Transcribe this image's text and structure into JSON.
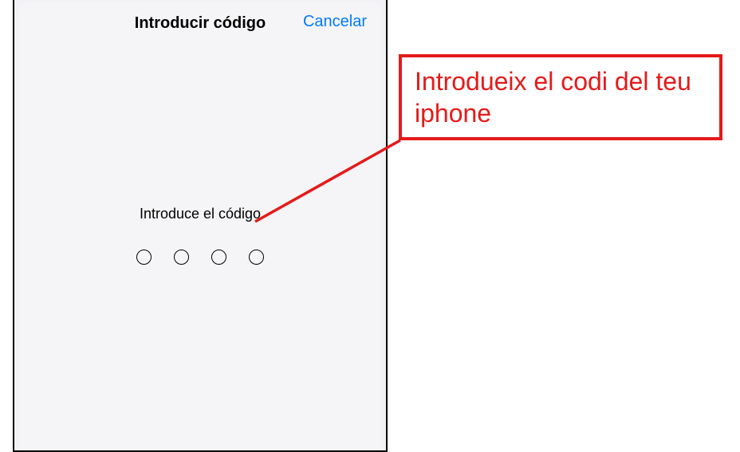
{
  "modal": {
    "title": "Introducir código",
    "cancel_label": "Cancelar",
    "prompt": "Introduce el código",
    "passcode_length": 4
  },
  "annotation": {
    "text": "Introdueix el codi del teu iphone"
  },
  "colors": {
    "accent_blue": "#007aff",
    "annotation_red": "#e51a1a",
    "panel_bg": "#f5f5f7"
  }
}
